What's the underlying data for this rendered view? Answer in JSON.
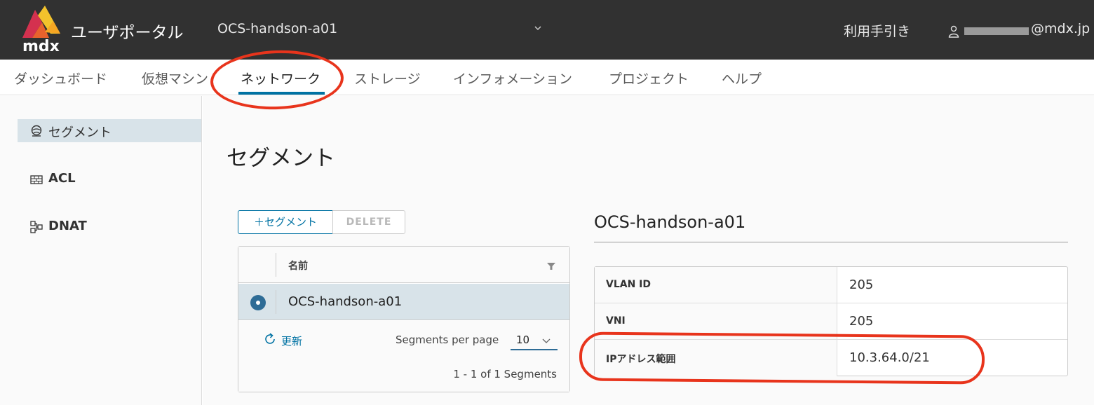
{
  "header": {
    "logo_text": "mdx",
    "app_title": "ユーザポータル",
    "project": "OCS-handson-a01",
    "guide_link": "利用手引き",
    "user_email": "@mdx.jp"
  },
  "nav": {
    "tabs": [
      {
        "label": "ダッシュボード"
      },
      {
        "label": "仮想マシン"
      },
      {
        "label": "ネットワーク",
        "active": true
      },
      {
        "label": "ストレージ"
      },
      {
        "label": "インフォメーション"
      },
      {
        "label": "プロジェクト"
      },
      {
        "label": "ヘルプ"
      }
    ]
  },
  "sidebar": {
    "items": [
      {
        "label": "セグメント",
        "icon": "segment-icon",
        "active": true
      },
      {
        "label": "ACL",
        "icon": "firewall-icon"
      },
      {
        "label": "DNAT",
        "icon": "dnat-icon"
      }
    ]
  },
  "main": {
    "page_title": "セグメント",
    "add_button": "＋セグメント",
    "delete_button": "DELETE",
    "grid": {
      "column_name": "名前",
      "rows": [
        {
          "name": "OCS-handson-a01",
          "selected": true
        }
      ],
      "refresh_label": "更新",
      "per_page_label": "Segments per page",
      "per_page_value": "10",
      "count_text": "1 - 1 of 1 Segments"
    },
    "detail": {
      "title": "OCS-handson-a01",
      "rows": [
        {
          "key": "VLAN ID",
          "value": "205"
        },
        {
          "key": "VNI",
          "value": "205"
        },
        {
          "key": "IPアドレス範囲",
          "value": "10.3.64.0/21"
        }
      ]
    }
  },
  "colors": {
    "header_bg": "#313131",
    "accent": "#0072a3",
    "selected_row": "#d8e3e9",
    "annotation": "#e8341c"
  }
}
